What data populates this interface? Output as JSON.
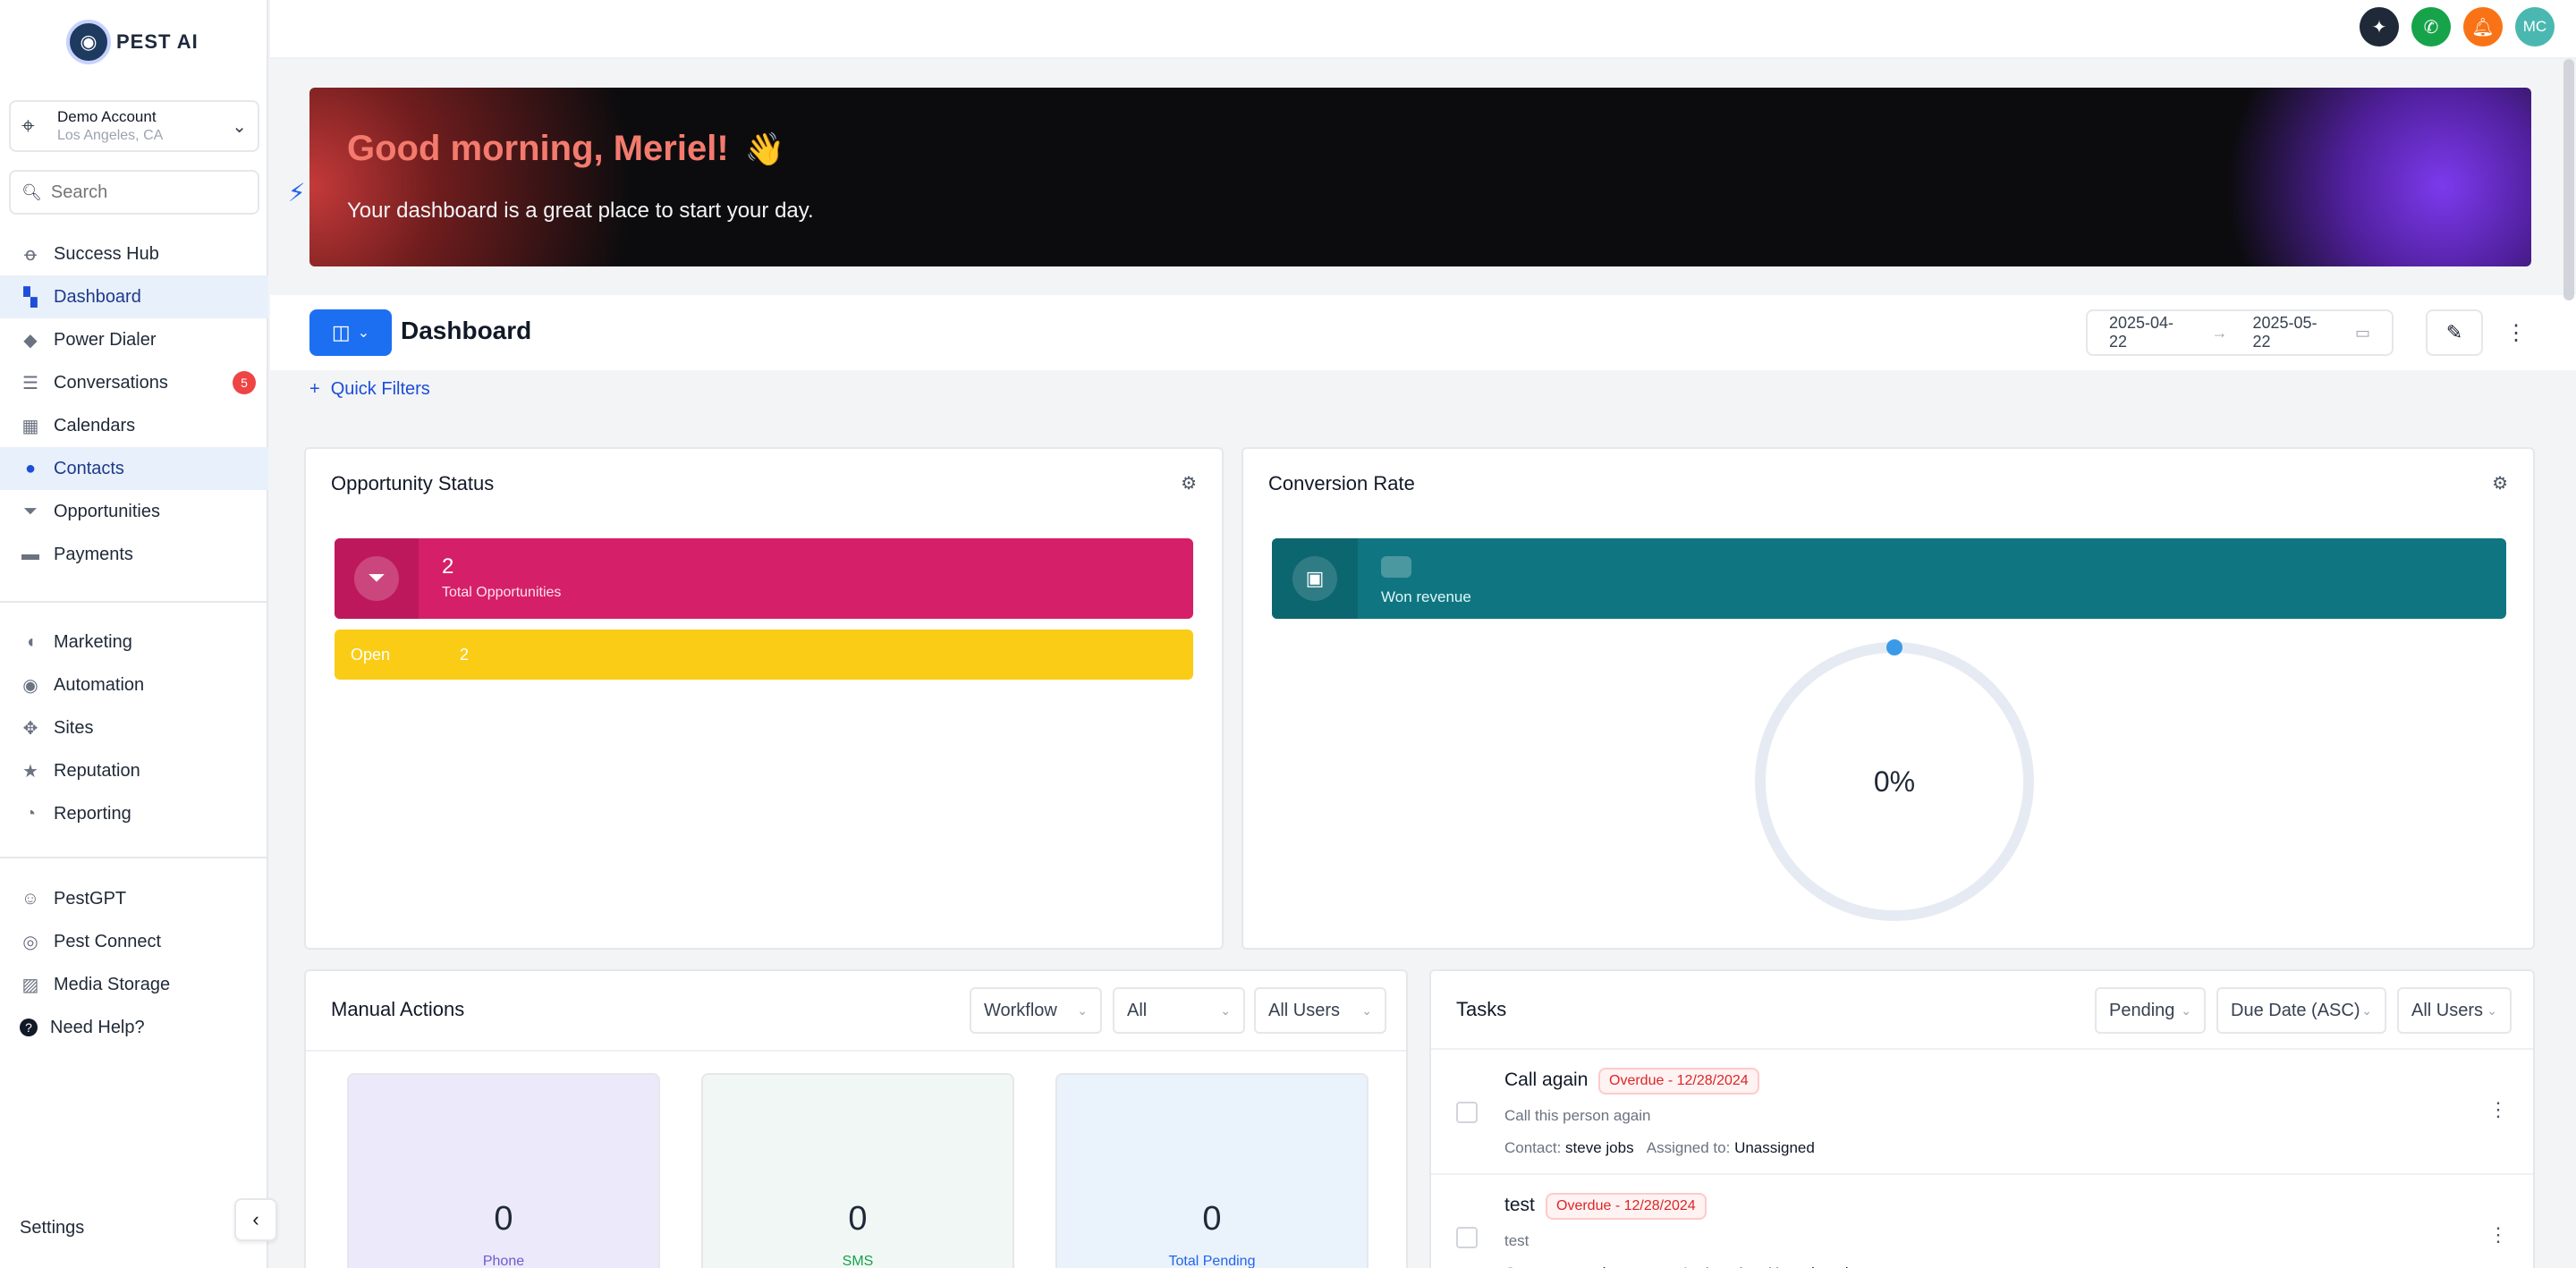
{
  "brand": {
    "name": "PEST AI"
  },
  "account": {
    "name": "Demo Account",
    "location": "Los Angeles, CA"
  },
  "search": {
    "placeholder": "Search"
  },
  "nav_main": [
    {
      "label": "Success Hub",
      "icon": "medal-icon"
    },
    {
      "label": "Dashboard",
      "icon": "dashboard-icon",
      "active": true
    },
    {
      "label": "Power Dialer",
      "icon": "diamond-icon"
    },
    {
      "label": "Conversations",
      "icon": "chat-icon",
      "badge": "5"
    },
    {
      "label": "Calendars",
      "icon": "calendar-icon"
    },
    {
      "label": "Contacts",
      "icon": "person-icon",
      "active": true
    },
    {
      "label": "Opportunities",
      "icon": "filter-icon"
    },
    {
      "label": "Payments",
      "icon": "card-icon"
    }
  ],
  "nav_secondary": [
    {
      "label": "Marketing",
      "icon": "megaphone-icon"
    },
    {
      "label": "Automation",
      "icon": "automation-icon"
    },
    {
      "label": "Sites",
      "icon": "sites-icon"
    },
    {
      "label": "Reputation",
      "icon": "star-icon"
    },
    {
      "label": "Reporting",
      "icon": "pie-icon"
    }
  ],
  "nav_tertiary": [
    {
      "label": "PestGPT",
      "icon": "bot-icon"
    },
    {
      "label": "Pest Connect",
      "icon": "connect-icon"
    },
    {
      "label": "Media Storage",
      "icon": "image-icon"
    },
    {
      "label": "Need Help?",
      "icon": "help-icon"
    }
  ],
  "settings_label": "Settings",
  "topbar": {
    "avatar_initials": "MC"
  },
  "hero": {
    "greeting": "Good morning, Meriel!",
    "subtitle": "Your dashboard is a great place to start your day."
  },
  "dashboard": {
    "title": "Dashboard",
    "date_start": "2025-04-22",
    "date_end": "2025-05-22",
    "quick_filters": "Quick Filters"
  },
  "opportunity_status": {
    "title": "Opportunity Status",
    "total_value": "2",
    "total_label": "Total Opportunities",
    "open_label": "Open",
    "open_value": "2"
  },
  "conversion_rate": {
    "title": "Conversion Rate",
    "won_label": "Won revenue",
    "rate": "0%"
  },
  "manual_actions": {
    "title": "Manual Actions",
    "filters": [
      "Workflow",
      "All",
      "All Users"
    ],
    "stats": [
      {
        "value": "0",
        "label": "Phone",
        "bg": "#ece9fb",
        "color": "#6d5bd0"
      },
      {
        "value": "0",
        "label": "SMS",
        "bg": "#f1f7f5",
        "color": "#16a34a"
      },
      {
        "value": "0",
        "label": "Total Pending",
        "bg": "#eaf3fc",
        "color": "#2563eb"
      }
    ]
  },
  "tasks": {
    "title": "Tasks",
    "filters": [
      "Pending",
      "Due Date (ASC)",
      "All Users"
    ],
    "contact_label": "Contact:",
    "assigned_label": "Assigned to:",
    "items": [
      {
        "title": "Call again",
        "badge": "Overdue - 12/28/2024",
        "description": "Call this person again",
        "contact": "steve jobs",
        "assigned": "Unassigned"
      },
      {
        "title": "test",
        "badge": "Overdue - 12/28/2024",
        "description": "test",
        "contact": "sample contact",
        "assigned": "Unassigned"
      }
    ]
  },
  "colors": {
    "accent": "#1d6ff2",
    "opportunity": "#d61f69",
    "open": "#facc15",
    "won": "#0f7681"
  }
}
